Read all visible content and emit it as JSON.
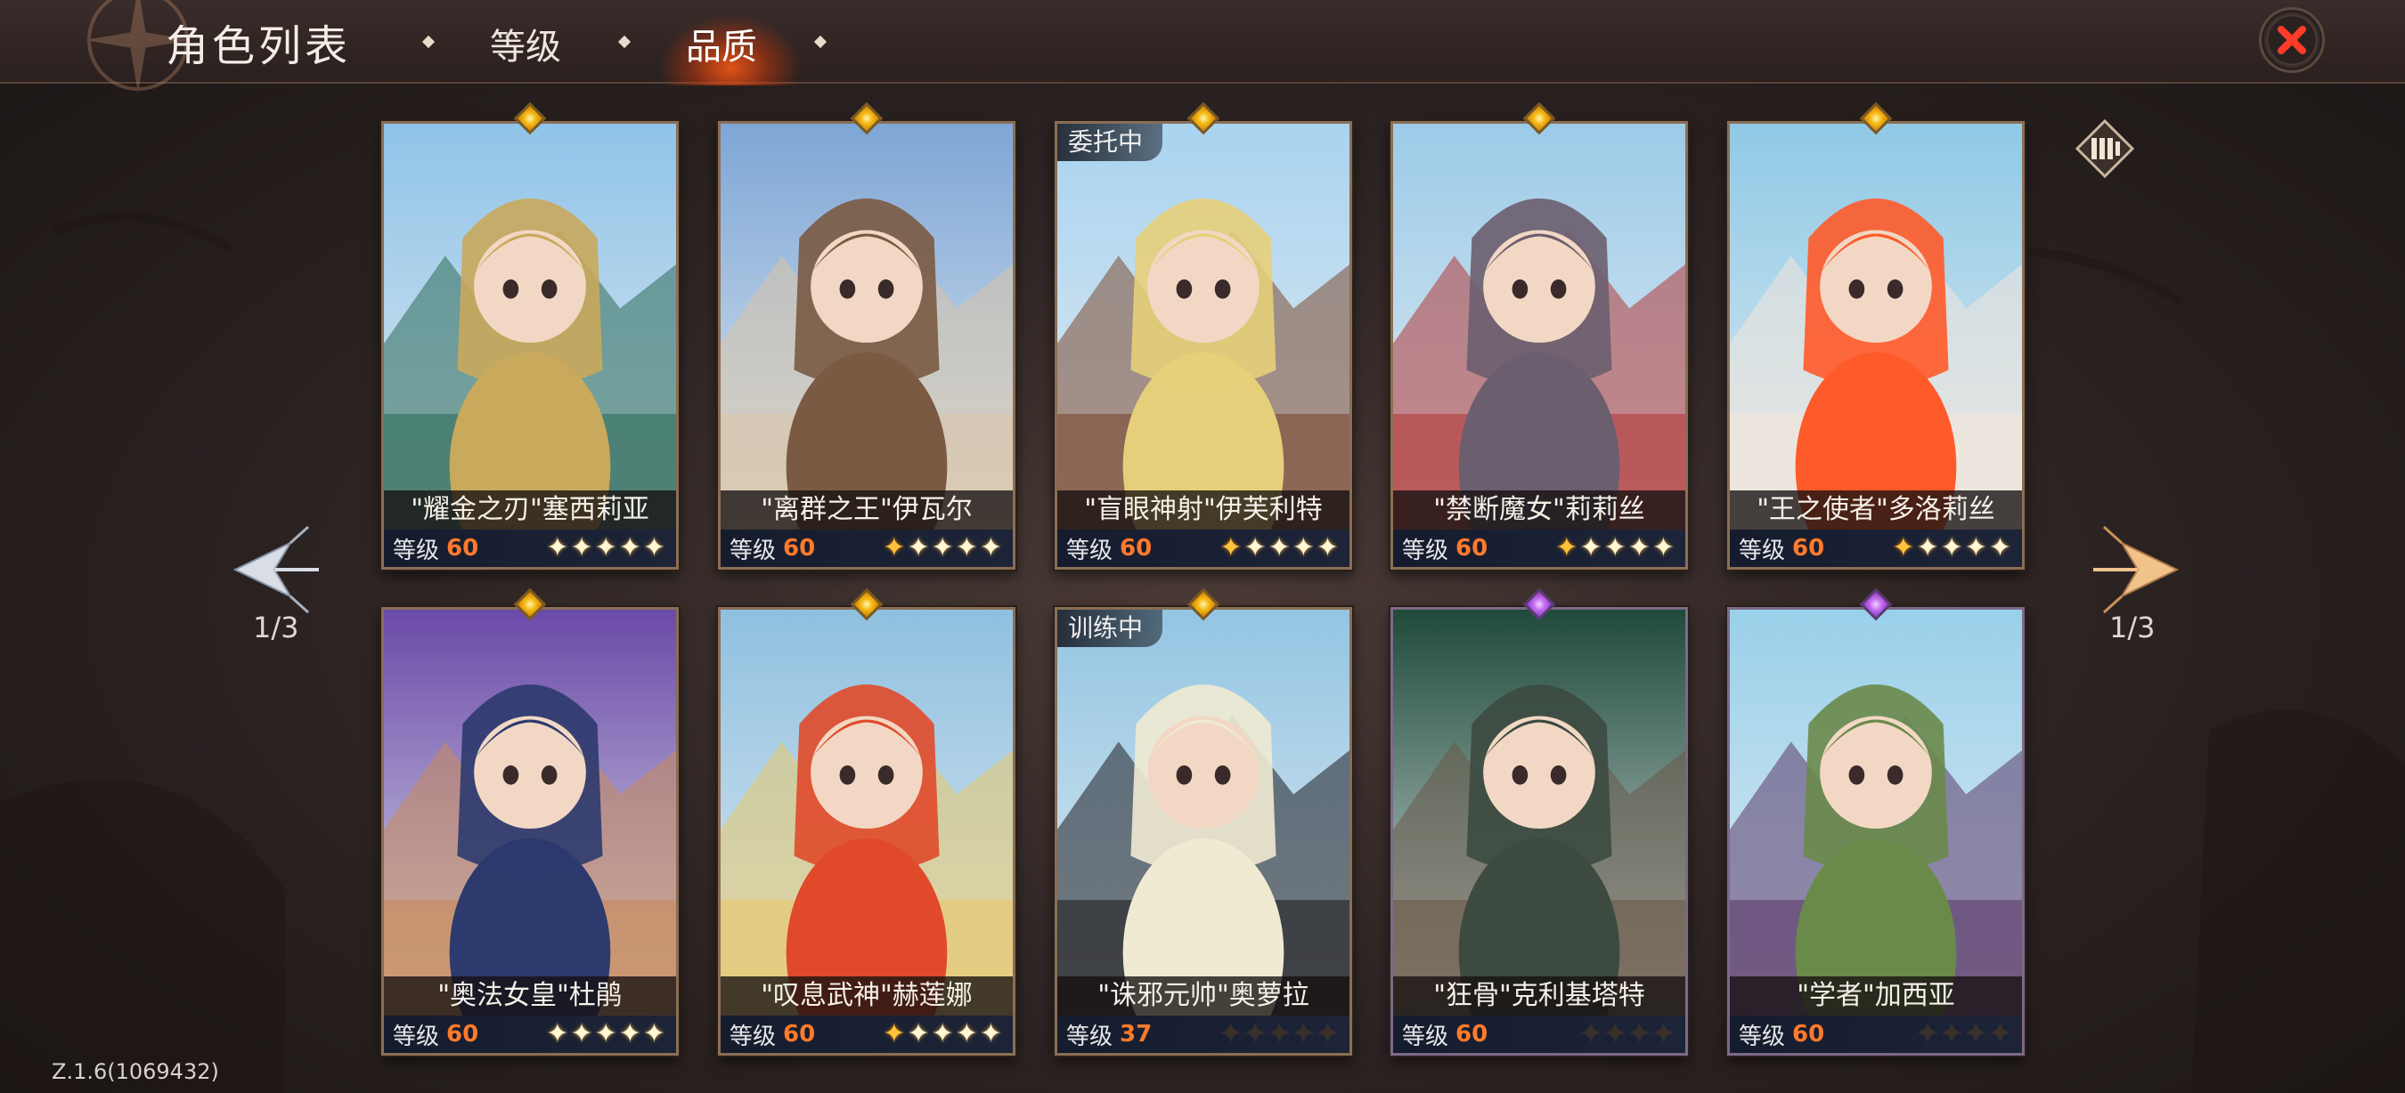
{
  "header": {
    "title": "角色列表",
    "tabs": [
      {
        "label": "等级",
        "active": false
      },
      {
        "label": "品质",
        "active": true
      }
    ]
  },
  "pagination": {
    "left": "1/3",
    "right": "1/3"
  },
  "version": "Z.1.6(1069432)",
  "level_label": "等级",
  "characters": [
    {
      "name": "\"耀金之刃\"塞西莉亚",
      "level": "60",
      "stars": 5,
      "lit": 5,
      "gem": "gold",
      "status": "",
      "palette": [
        "#8fc3e8",
        "#c9a95c",
        "#2f6b5a"
      ]
    },
    {
      "name": "\"离群之王\"伊瓦尔",
      "level": "60",
      "stars": 5,
      "lit": 5,
      "gem": "gold",
      "status": "",
      "palette": [
        "#7ea6d6",
        "#7a5a42",
        "#d8c4a8"
      ]
    },
    {
      "name": "\"盲眼神射\"伊芙利特",
      "level": "60",
      "stars": 5,
      "lit": 5,
      "gem": "gold",
      "status": "委托中",
      "palette": [
        "#a9d3ef",
        "#e6cf7a",
        "#7b4a32"
      ]
    },
    {
      "name": "\"禁断魔女\"莉莉丝",
      "level": "60",
      "stars": 5,
      "lit": 5,
      "gem": "gold",
      "status": "",
      "palette": [
        "#9ccbe8",
        "#6b5e6e",
        "#b23a3a"
      ]
    },
    {
      "name": "\"王之使者\"多洛莉丝",
      "level": "60",
      "stars": 5,
      "lit": 5,
      "gem": "gold",
      "status": "",
      "palette": [
        "#8fc9e6",
        "#ff5a2a",
        "#f2e6da"
      ]
    },
    {
      "name": "\"奥法女皇\"杜鹃",
      "level": "60",
      "stars": 5,
      "lit": 5,
      "gem": "gold",
      "status": "",
      "palette": [
        "#6a4aa8",
        "#2c3a6e",
        "#c88a5a"
      ]
    },
    {
      "name": "\"叹息武神\"赫莲娜",
      "level": "60",
      "stars": 5,
      "lit": 5,
      "gem": "gold",
      "status": "",
      "palette": [
        "#8fc0e0",
        "#e04a2a",
        "#e8c86a"
      ]
    },
    {
      "name": "\"诛邪元帅\"奥萝拉",
      "level": "37",
      "stars": 5,
      "lit": 0,
      "gem": "gold",
      "status": "训练中",
      "palette": [
        "#93c5e3",
        "#f0ead2",
        "#1e1e22"
      ]
    },
    {
      "name": "\"狂骨\"克利基塔特",
      "level": "60",
      "stars": 4,
      "lit": 0,
      "gem": "purple",
      "status": "",
      "palette": [
        "#1f4a3a",
        "#3c4a40",
        "#6a5a48"
      ]
    },
    {
      "name": "\"学者\"加西亚",
      "level": "60",
      "stars": 4,
      "lit": 0,
      "gem": "purple",
      "status": "",
      "palette": [
        "#9ad0ea",
        "#6a8a4a",
        "#5a3a6a"
      ]
    }
  ],
  "colors": {
    "accent": "#ff7a2a",
    "gold_gem": "#f5b915",
    "purple_gem": "#c56ff0"
  }
}
